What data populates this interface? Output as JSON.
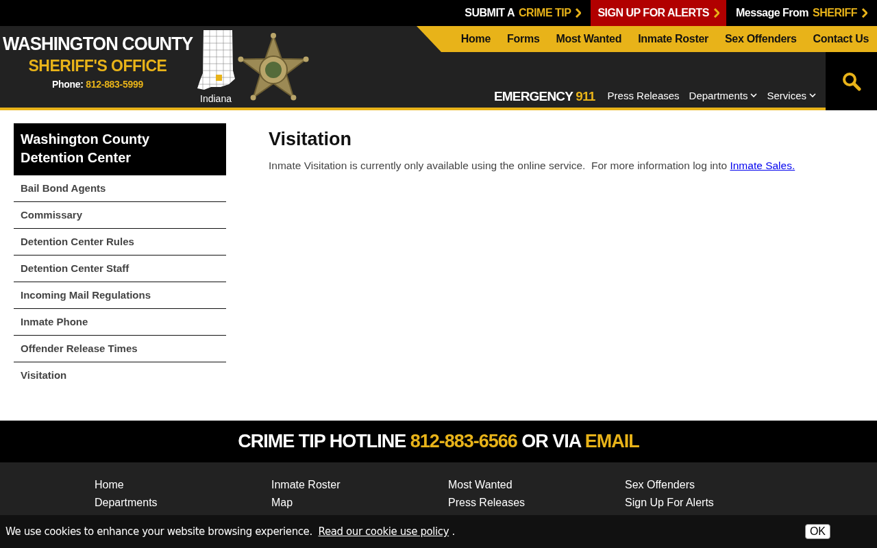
{
  "top_bar": [
    {
      "kind": "plain",
      "text": "SUBMIT A",
      "highlight": "CRIME TIP"
    },
    {
      "kind": "alert",
      "text": "SIGN UP FOR ALERTS"
    },
    {
      "kind": "plain",
      "text": "Message From",
      "highlight": "SHERIFF"
    }
  ],
  "header": {
    "title": "WASHINGTON COUNTY",
    "subtitle": "SHERIFF'S OFFICE",
    "phone_label": "Phone:",
    "phone": "812-883-5999",
    "map_label": "Indiana"
  },
  "main_nav": [
    "Home",
    "Forms",
    "Most Wanted",
    "Inmate Roster",
    "Sex Offenders",
    "Contact Us"
  ],
  "emergency": {
    "label": "EMERGENCY",
    "number": "911"
  },
  "secondary_nav": [
    {
      "label": "Press Releases",
      "dropdown": false
    },
    {
      "label": "Departments",
      "dropdown": true
    },
    {
      "label": "Services",
      "dropdown": true
    }
  ],
  "sidebar": {
    "title": "Washington County Detention Center",
    "items": [
      "Bail Bond Agents",
      "Commissary",
      "Detention Center Rules",
      "Detention Center Staff",
      "Incoming Mail Regulations",
      "Inmate Phone",
      "Offender Release Times",
      "Visitation"
    ]
  },
  "content": {
    "heading": "Visitation",
    "text": "Inmate Visitation is currently only available using the online service.  For more information log into",
    "link": "Inmate Sales."
  },
  "hotline": {
    "label": "CRIME TIP HOTLINE",
    "phone": "812-883-6566",
    "middle": "OR VIA",
    "link": "EMAIL"
  },
  "footer_links": [
    [
      "Home",
      "Departments"
    ],
    [
      "Inmate Roster",
      "Map"
    ],
    [
      "Most Wanted",
      "Press Releases"
    ],
    [
      "Sex Offenders",
      "Sign Up For Alerts"
    ]
  ],
  "cookie_bar": {
    "text": "We use cookies to enhance your website browsing experience.",
    "link": "Read our cookie use policy",
    "after": ".",
    "button": "OK"
  }
}
